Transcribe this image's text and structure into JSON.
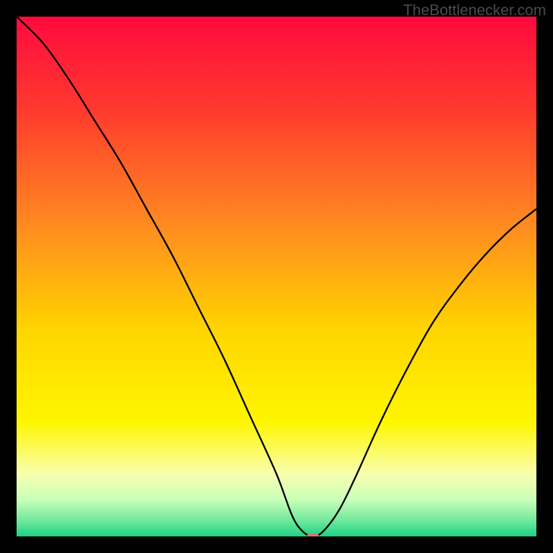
{
  "watermark": "TheBottlenecker.com",
  "chart_data": {
    "type": "line",
    "title": "",
    "xlabel": "",
    "ylabel": "",
    "xlim": [
      0,
      100
    ],
    "ylim": [
      0,
      100
    ],
    "background": {
      "type": "vertical-gradient",
      "stops": [
        {
          "pos": 0,
          "color": "#ff0a3e"
        },
        {
          "pos": 18,
          "color": "#ff3a2e"
        },
        {
          "pos": 40,
          "color": "#ff8a20"
        },
        {
          "pos": 60,
          "color": "#ffd400"
        },
        {
          "pos": 78,
          "color": "#fff600"
        },
        {
          "pos": 88,
          "color": "#f8ffb0"
        },
        {
          "pos": 93,
          "color": "#c8ffb8"
        },
        {
          "pos": 97,
          "color": "#6fe89a"
        },
        {
          "pos": 100,
          "color": "#1cd286"
        }
      ]
    },
    "series": [
      {
        "name": "curve",
        "x": [
          0,
          5,
          10,
          15,
          20,
          25,
          30,
          35,
          40,
          45,
          50,
          53,
          55,
          57,
          59,
          62,
          65,
          70,
          75,
          80,
          85,
          90,
          95,
          100
        ],
        "y": [
          100,
          95,
          88,
          80,
          72,
          63,
          54,
          44,
          34,
          23,
          12,
          4,
          1,
          0,
          1,
          5,
          11,
          22,
          32,
          41,
          48,
          54,
          59,
          63
        ]
      }
    ],
    "marker": {
      "x": 57,
      "y": 0,
      "color": "#d57a6f",
      "rx": 9,
      "ry": 5
    },
    "stroke": {
      "color": "#000000",
      "width": 2.4
    }
  }
}
